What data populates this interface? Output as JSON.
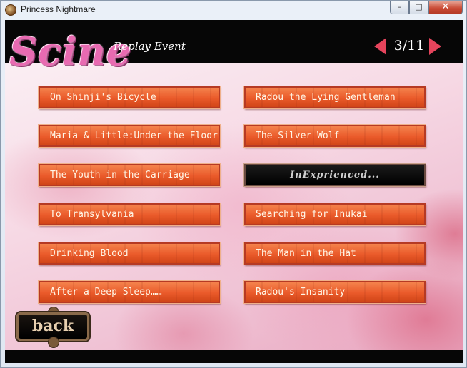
{
  "window": {
    "title": "Princess Nightmare",
    "controls": {
      "minimize": "–",
      "maximize": "□",
      "close": "✕"
    }
  },
  "header": {
    "logo": "Scine",
    "subtitle": "Replay Event",
    "page": "3/11"
  },
  "events": {
    "left": [
      "On Shinji's Bicycle",
      "Maria & Little:Under the Floor",
      "The Youth in the Carriage",
      "To Transylvania",
      "Drinking Blood",
      "After a Deep Sleep……"
    ],
    "right": [
      "Radou the Lying Gentleman",
      "The Silver Wolf",
      "InExprienced...",
      "Searching for Inukai",
      "The Man in the Hat",
      "Radou's Insanity"
    ]
  },
  "footer": {
    "back_label": "back"
  },
  "colors": {
    "accent": "#e5445c",
    "button": "#ea5a2a",
    "bar": "#060606"
  }
}
